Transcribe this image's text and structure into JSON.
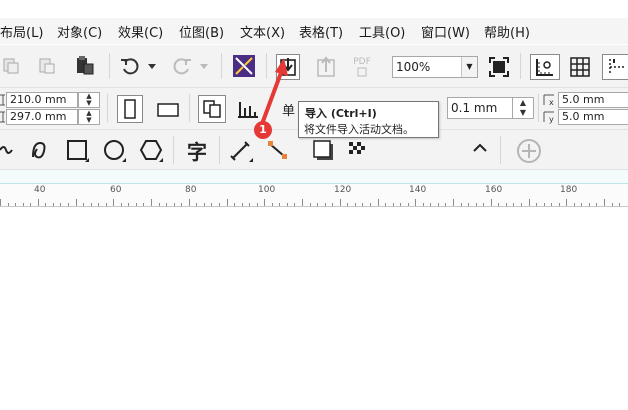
{
  "menubar": {
    "items": [
      {
        "label": "布局(L)"
      },
      {
        "label": "对象(C)"
      },
      {
        "label": "效果(C)"
      },
      {
        "label": "位图(B)"
      },
      {
        "label": "文本(X)"
      },
      {
        "label": "表格(T)"
      },
      {
        "label": "工具(O)"
      },
      {
        "label": "窗口(W)"
      },
      {
        "label": "帮助(H)"
      }
    ]
  },
  "toolbar": {
    "zoom_value": "100%",
    "pdf_label": "PDF",
    "icons": [
      "copy-icon",
      "paste-icon",
      "clipboard-icon",
      "undo-icon",
      "redo-icon",
      "launcher-icon",
      "import-icon",
      "export-icon",
      "export-pdf-icon",
      "full-screen-icon",
      "show-rulers-icon",
      "show-grid-icon"
    ]
  },
  "property_bar": {
    "width_value": "210.0 mm",
    "height_value": "297.0 mm",
    "units_label": "单",
    "nudge_value": "0.1 mm",
    "dup_x_value": "5.0 mm",
    "dup_y_value": "5.0 mm",
    "dup_x_label": "x",
    "dup_y_label": "y"
  },
  "toolbox": {
    "text_tool_glyph": "字"
  },
  "ruler": {
    "labels": [
      "40",
      "60",
      "80",
      "100",
      "120",
      "140",
      "160",
      "180"
    ]
  },
  "tooltip": {
    "title": "导入 (Ctrl+I)",
    "description": "将文件导入活动文档。"
  },
  "annotation": {
    "badge_number": "1",
    "color": "#e53935"
  }
}
